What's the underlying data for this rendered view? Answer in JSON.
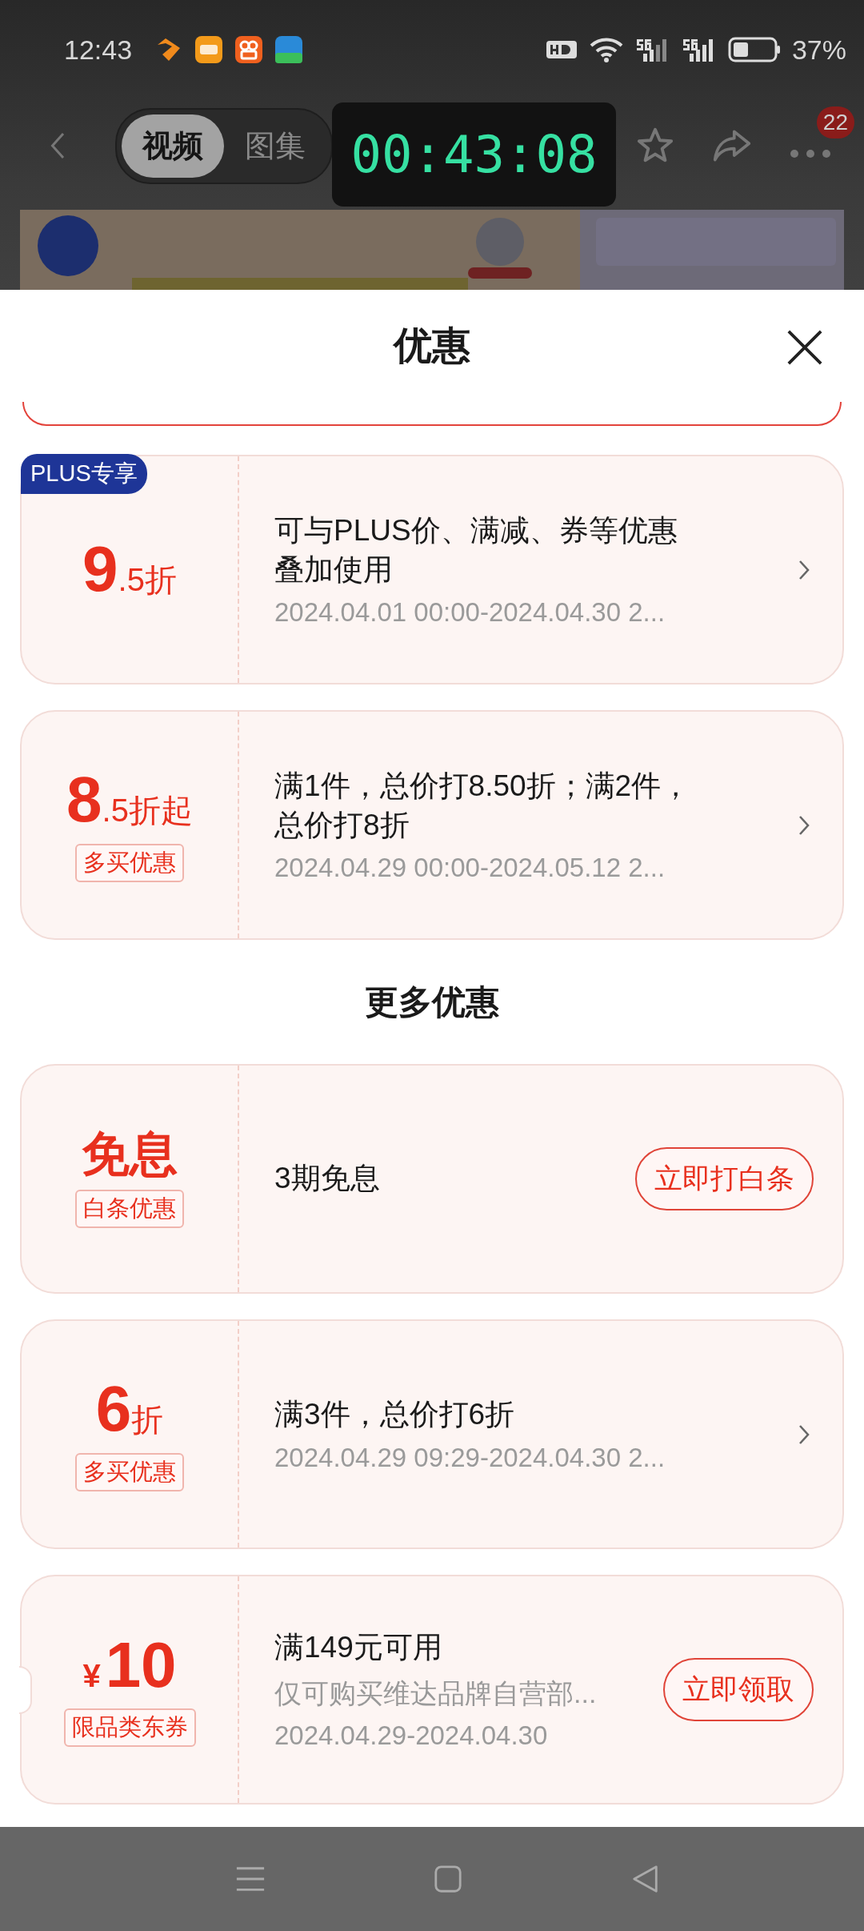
{
  "status_bar": {
    "time": "12:43",
    "battery": "37%"
  },
  "nav": {
    "tabs": [
      {
        "label": "视频",
        "selected": true
      },
      {
        "label": "图集",
        "selected": false
      }
    ],
    "badge": "22"
  },
  "timer": "00:43:08",
  "sheet": {
    "title": "优惠",
    "groups": [
      {
        "offers": [
          {
            "kind": "promo",
            "corner_badge": "PLUS专享",
            "value": {
              "kind": "number",
              "amount": "9",
              "suffix": ".5折"
            },
            "title": "可与PLUS价、满减、券等优惠叠加使用",
            "period": "2024.04.01 00:00-2024.04.30 2...",
            "action": {
              "kind": "chevron"
            }
          },
          {
            "kind": "promo",
            "value": {
              "kind": "number",
              "amount": "8",
              "suffix": ".5折起"
            },
            "tag": "多买优惠",
            "title": "满1件，总价打8.50折；满2件，总价打8折",
            "period": "2024.04.29 00:00-2024.05.12 2...",
            "action": {
              "kind": "chevron"
            }
          }
        ]
      },
      {
        "heading": "更多优惠",
        "offers": [
          {
            "kind": "promo",
            "value": {
              "kind": "word",
              "amount": "免息"
            },
            "tag": "白条优惠",
            "title": "3期免息",
            "action": {
              "kind": "button",
              "label": "立即打白条"
            }
          },
          {
            "kind": "promo",
            "value": {
              "kind": "number",
              "amount": "6",
              "suffix": "折"
            },
            "tag": "多买优惠",
            "title": "满3件，总价打6折",
            "period": "2024.04.29 09:29-2024.04.30 2...",
            "action": {
              "kind": "chevron"
            }
          },
          {
            "kind": "coupon",
            "value": {
              "kind": "number",
              "prefix": "¥",
              "amount": "10"
            },
            "tag": "限品类东券",
            "title": "满149元可用",
            "note": "仅可购买维达品牌自营部...",
            "period": "2024.04.29-2024.04.30",
            "action": {
              "kind": "button",
              "label": "立即领取"
            }
          }
        ]
      }
    ]
  }
}
